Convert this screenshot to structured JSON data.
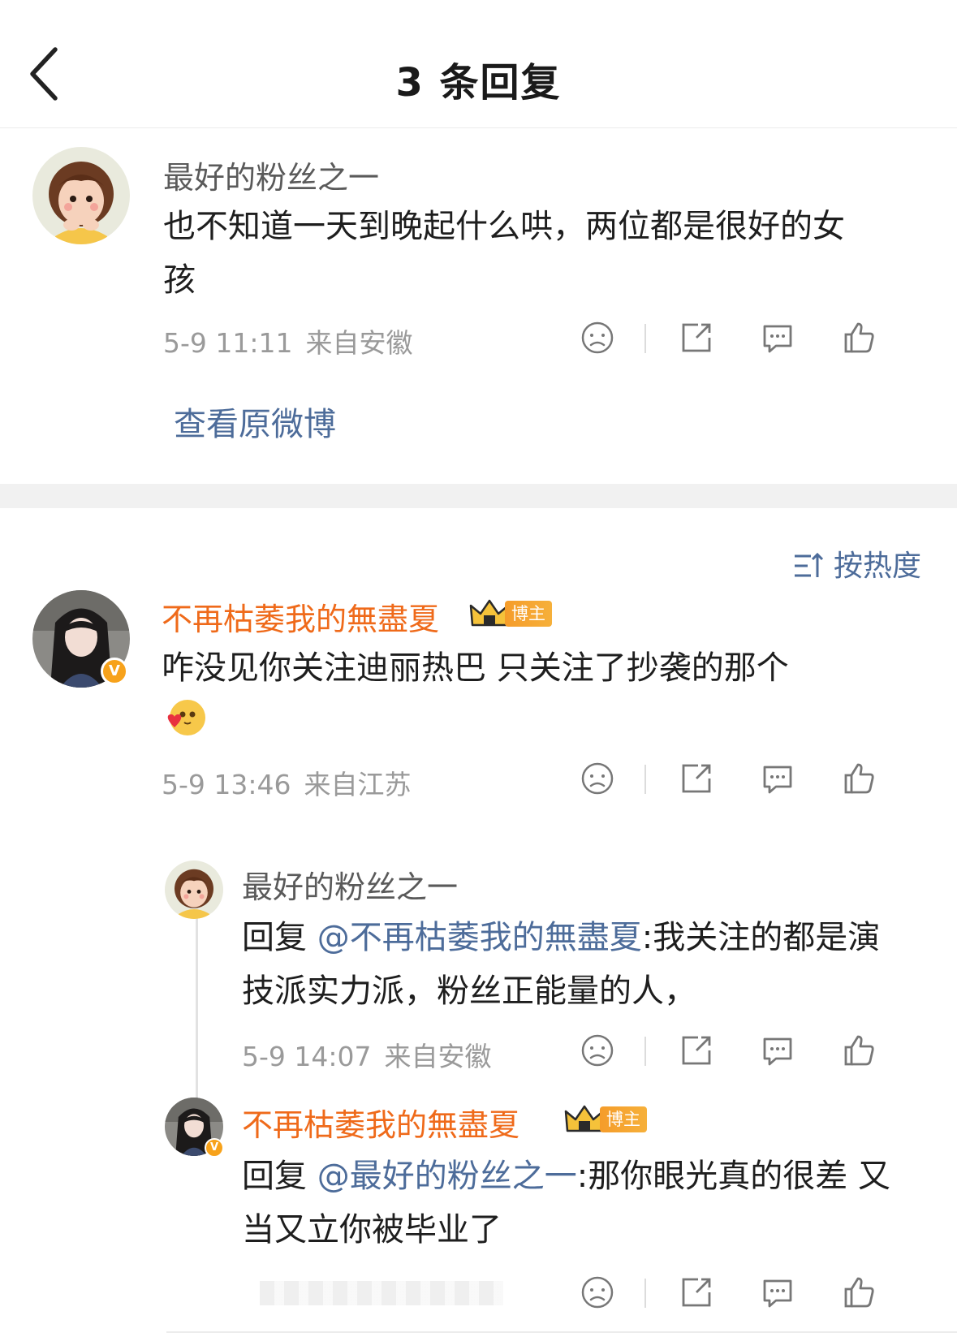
{
  "header": {
    "title": "3 条回复"
  },
  "main_comment": {
    "username": "最好的粉丝之一",
    "text": "也不知道一天到晚起什么哄，两位都是很好的女孩",
    "date": "5-9 11:11",
    "location": "来自安徽",
    "view_original": "查看原微博"
  },
  "sort": {
    "label": "按热度"
  },
  "replies": [
    {
      "username": "不再枯萎我的無盡夏",
      "badge": "博主",
      "text": "咋没见你关注迪丽热巴 只关注了抄袭的那个",
      "emoji": "love-emoji",
      "date": "5-9 13:46",
      "location": "来自江苏",
      "verified_mark": "V"
    },
    {
      "username": "最好的粉丝之一",
      "reply_prefix": "回复 ",
      "mention": "@不再枯萎我的無盡夏",
      "text": ":我关注的都是演技派实力派，粉丝正能量的人，",
      "date": "5-9 14:07",
      "location": "来自安徽"
    },
    {
      "username": "不再枯萎我的無盡夏",
      "badge": "博主",
      "reply_prefix": "回复 ",
      "mention": "@最好的粉丝之一",
      "text": ":那你眼光真的很差 又当又立你被毕业了",
      "verified_mark": "V"
    }
  ],
  "icons": [
    "back-arrow-icon",
    "dislike-face-icon",
    "share-icon",
    "comment-icon",
    "like-icon",
    "sort-icon",
    "crown-icon"
  ],
  "colors": {
    "vip_name": "#ef6a1a",
    "mention": "#4d6c9a",
    "meta": "#9a9a9a",
    "badge": "#f59c2a"
  }
}
